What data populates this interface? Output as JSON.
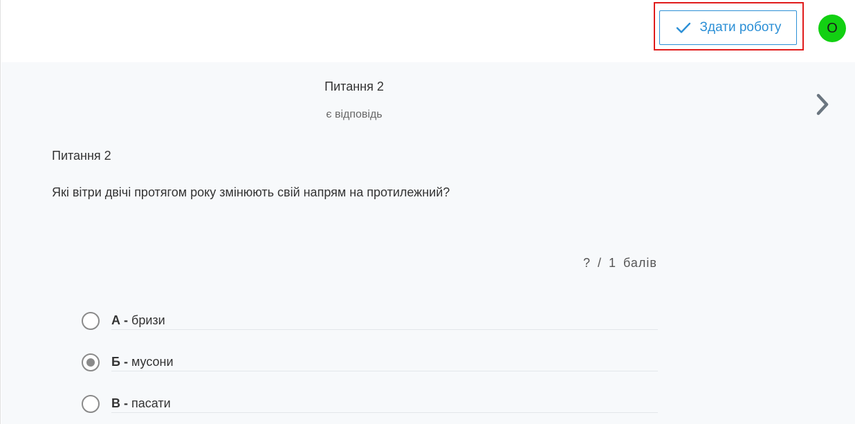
{
  "toolbar": {
    "submit_label": "Здати роботу",
    "submit_icon": "check-icon",
    "accent_color": "#2b8fd6"
  },
  "user": {
    "avatar_initial": "О",
    "avatar_color": "#12d012"
  },
  "question_nav": {
    "title": "Питання 2",
    "status": "є відповідь",
    "next_icon": "chevron-right-icon"
  },
  "question": {
    "number_label": "Питання 2",
    "text": "Які вітри двічі протягом року змінюють свій напрям на протилежний?",
    "score": "? / 1 балів",
    "options": [
      {
        "letter": "А -",
        "text": "бризи",
        "selected": false
      },
      {
        "letter": "Б -",
        "text": "мусони",
        "selected": true
      },
      {
        "letter": "В -",
        "text": "пасати",
        "selected": false
      }
    ]
  }
}
